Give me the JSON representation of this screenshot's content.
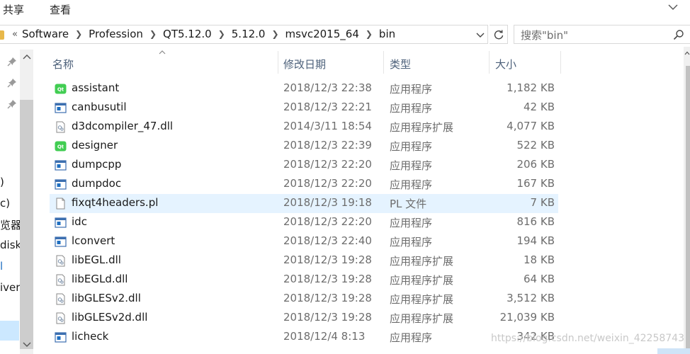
{
  "ribbon": {
    "tabs": [
      "共享",
      "查看"
    ]
  },
  "address": {
    "overflow": "«",
    "crumbs": [
      "Software",
      "Profession",
      "QT5.12.0",
      "5.12.0",
      "msvc2015_64",
      "bin"
    ]
  },
  "search": {
    "placeholder": "搜索\"bin\""
  },
  "nav": {
    "labels": [
      ")",
      "c)",
      "览器",
      "diskl",
      "l",
      "iver"
    ]
  },
  "columns": {
    "name": "名称",
    "date": "修改日期",
    "type": "类型",
    "size": "大小"
  },
  "files": [
    {
      "name": "assistant",
      "date": "2018/12/3 22:38",
      "type": "应用程序",
      "size": "1,182 KB",
      "icon": "qt-app-icon"
    },
    {
      "name": "canbusutil",
      "date": "2018/12/3 22:21",
      "type": "应用程序",
      "size": "42 KB",
      "icon": "exe-icon"
    },
    {
      "name": "d3dcompiler_47.dll",
      "date": "2014/3/11 18:54",
      "type": "应用程序扩展",
      "size": "4,077 KB",
      "icon": "dll-icon"
    },
    {
      "name": "designer",
      "date": "2018/12/3 22:39",
      "type": "应用程序",
      "size": "522 KB",
      "icon": "qt-app-icon"
    },
    {
      "name": "dumpcpp",
      "date": "2018/12/3 22:20",
      "type": "应用程序",
      "size": "206 KB",
      "icon": "exe-icon"
    },
    {
      "name": "dumpdoc",
      "date": "2018/12/3 22:20",
      "type": "应用程序",
      "size": "167 KB",
      "icon": "exe-icon"
    },
    {
      "name": "fixqt4headers.pl",
      "date": "2018/12/3 19:18",
      "type": "PL 文件",
      "size": "7 KB",
      "icon": "file-icon"
    },
    {
      "name": "idc",
      "date": "2018/12/3 22:20",
      "type": "应用程序",
      "size": "816 KB",
      "icon": "exe-icon"
    },
    {
      "name": "lconvert",
      "date": "2018/12/3 22:40",
      "type": "应用程序",
      "size": "194 KB",
      "icon": "exe-icon"
    },
    {
      "name": "libEGL.dll",
      "date": "2018/12/3 19:28",
      "type": "应用程序扩展",
      "size": "18 KB",
      "icon": "dll-icon"
    },
    {
      "name": "libEGLd.dll",
      "date": "2018/12/3 19:28",
      "type": "应用程序扩展",
      "size": "64 KB",
      "icon": "dll-icon"
    },
    {
      "name": "libGLESv2.dll",
      "date": "2018/12/3 19:28",
      "type": "应用程序扩展",
      "size": "3,512 KB",
      "icon": "dll-icon"
    },
    {
      "name": "libGLESv2d.dll",
      "date": "2018/12/3 19:28",
      "type": "应用程序扩展",
      "size": "21,039 KB",
      "icon": "dll-icon"
    },
    {
      "name": "licheck",
      "date": "2018/12/4 8:13",
      "type": "应用程序",
      "size": "342 KB",
      "icon": "exe-icon"
    }
  ],
  "hover_row": "fixqt4headers.pl",
  "watermark": "https://blog.csdn.net/weixin_42258743",
  "colors": {
    "header_text": "#4c607a",
    "hover_bg": "#e5f3ff",
    "selection_bg": "#cce8ff",
    "exe_blue": "#1f6fc1",
    "qt_green": "#41cd52"
  }
}
